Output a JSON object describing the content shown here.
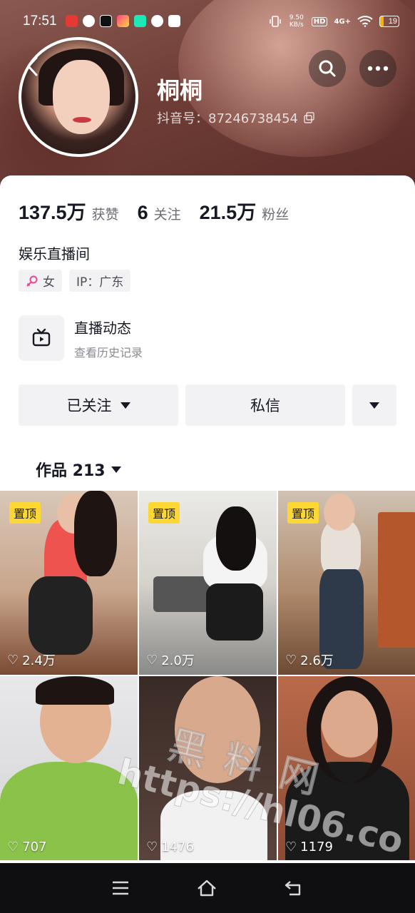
{
  "status_bar": {
    "time": "17:51",
    "network_speed": "9.50 KB/s",
    "hd_label": "HD",
    "signal": "4G+",
    "battery": "19"
  },
  "profile": {
    "nickname": "桐桐",
    "douyin_id": "抖音号：87246738454",
    "bio": "娱乐直播间",
    "gender_tag": "女",
    "ip_tag": "IP：广东"
  },
  "stats": [
    {
      "value": "137.5万",
      "label": "获赞"
    },
    {
      "value": "6",
      "label": "关注"
    },
    {
      "value": "21.5万",
      "label": "粉丝"
    }
  ],
  "live": {
    "title": "直播动态",
    "subtitle": "查看历史记录"
  },
  "actions": {
    "follow_label": "已关注",
    "message_label": "私信"
  },
  "works": {
    "tab_label": "作品 213"
  },
  "videos": [
    {
      "pinned": "置顶",
      "likes": "2.4万"
    },
    {
      "pinned": "置顶",
      "likes": "2.0万"
    },
    {
      "pinned": "置顶",
      "likes": "2.6万"
    },
    {
      "pinned": "",
      "likes": "707"
    },
    {
      "pinned": "",
      "likes": "1476"
    },
    {
      "pinned": "",
      "likes": "1179"
    }
  ],
  "watermark": {
    "brand": "黑料网",
    "url": "https://hl06.co"
  },
  "colors": {
    "pin_badge": "#fdd835",
    "header_bg": "#6e3d36",
    "button_bg": "#f2f2f4"
  }
}
